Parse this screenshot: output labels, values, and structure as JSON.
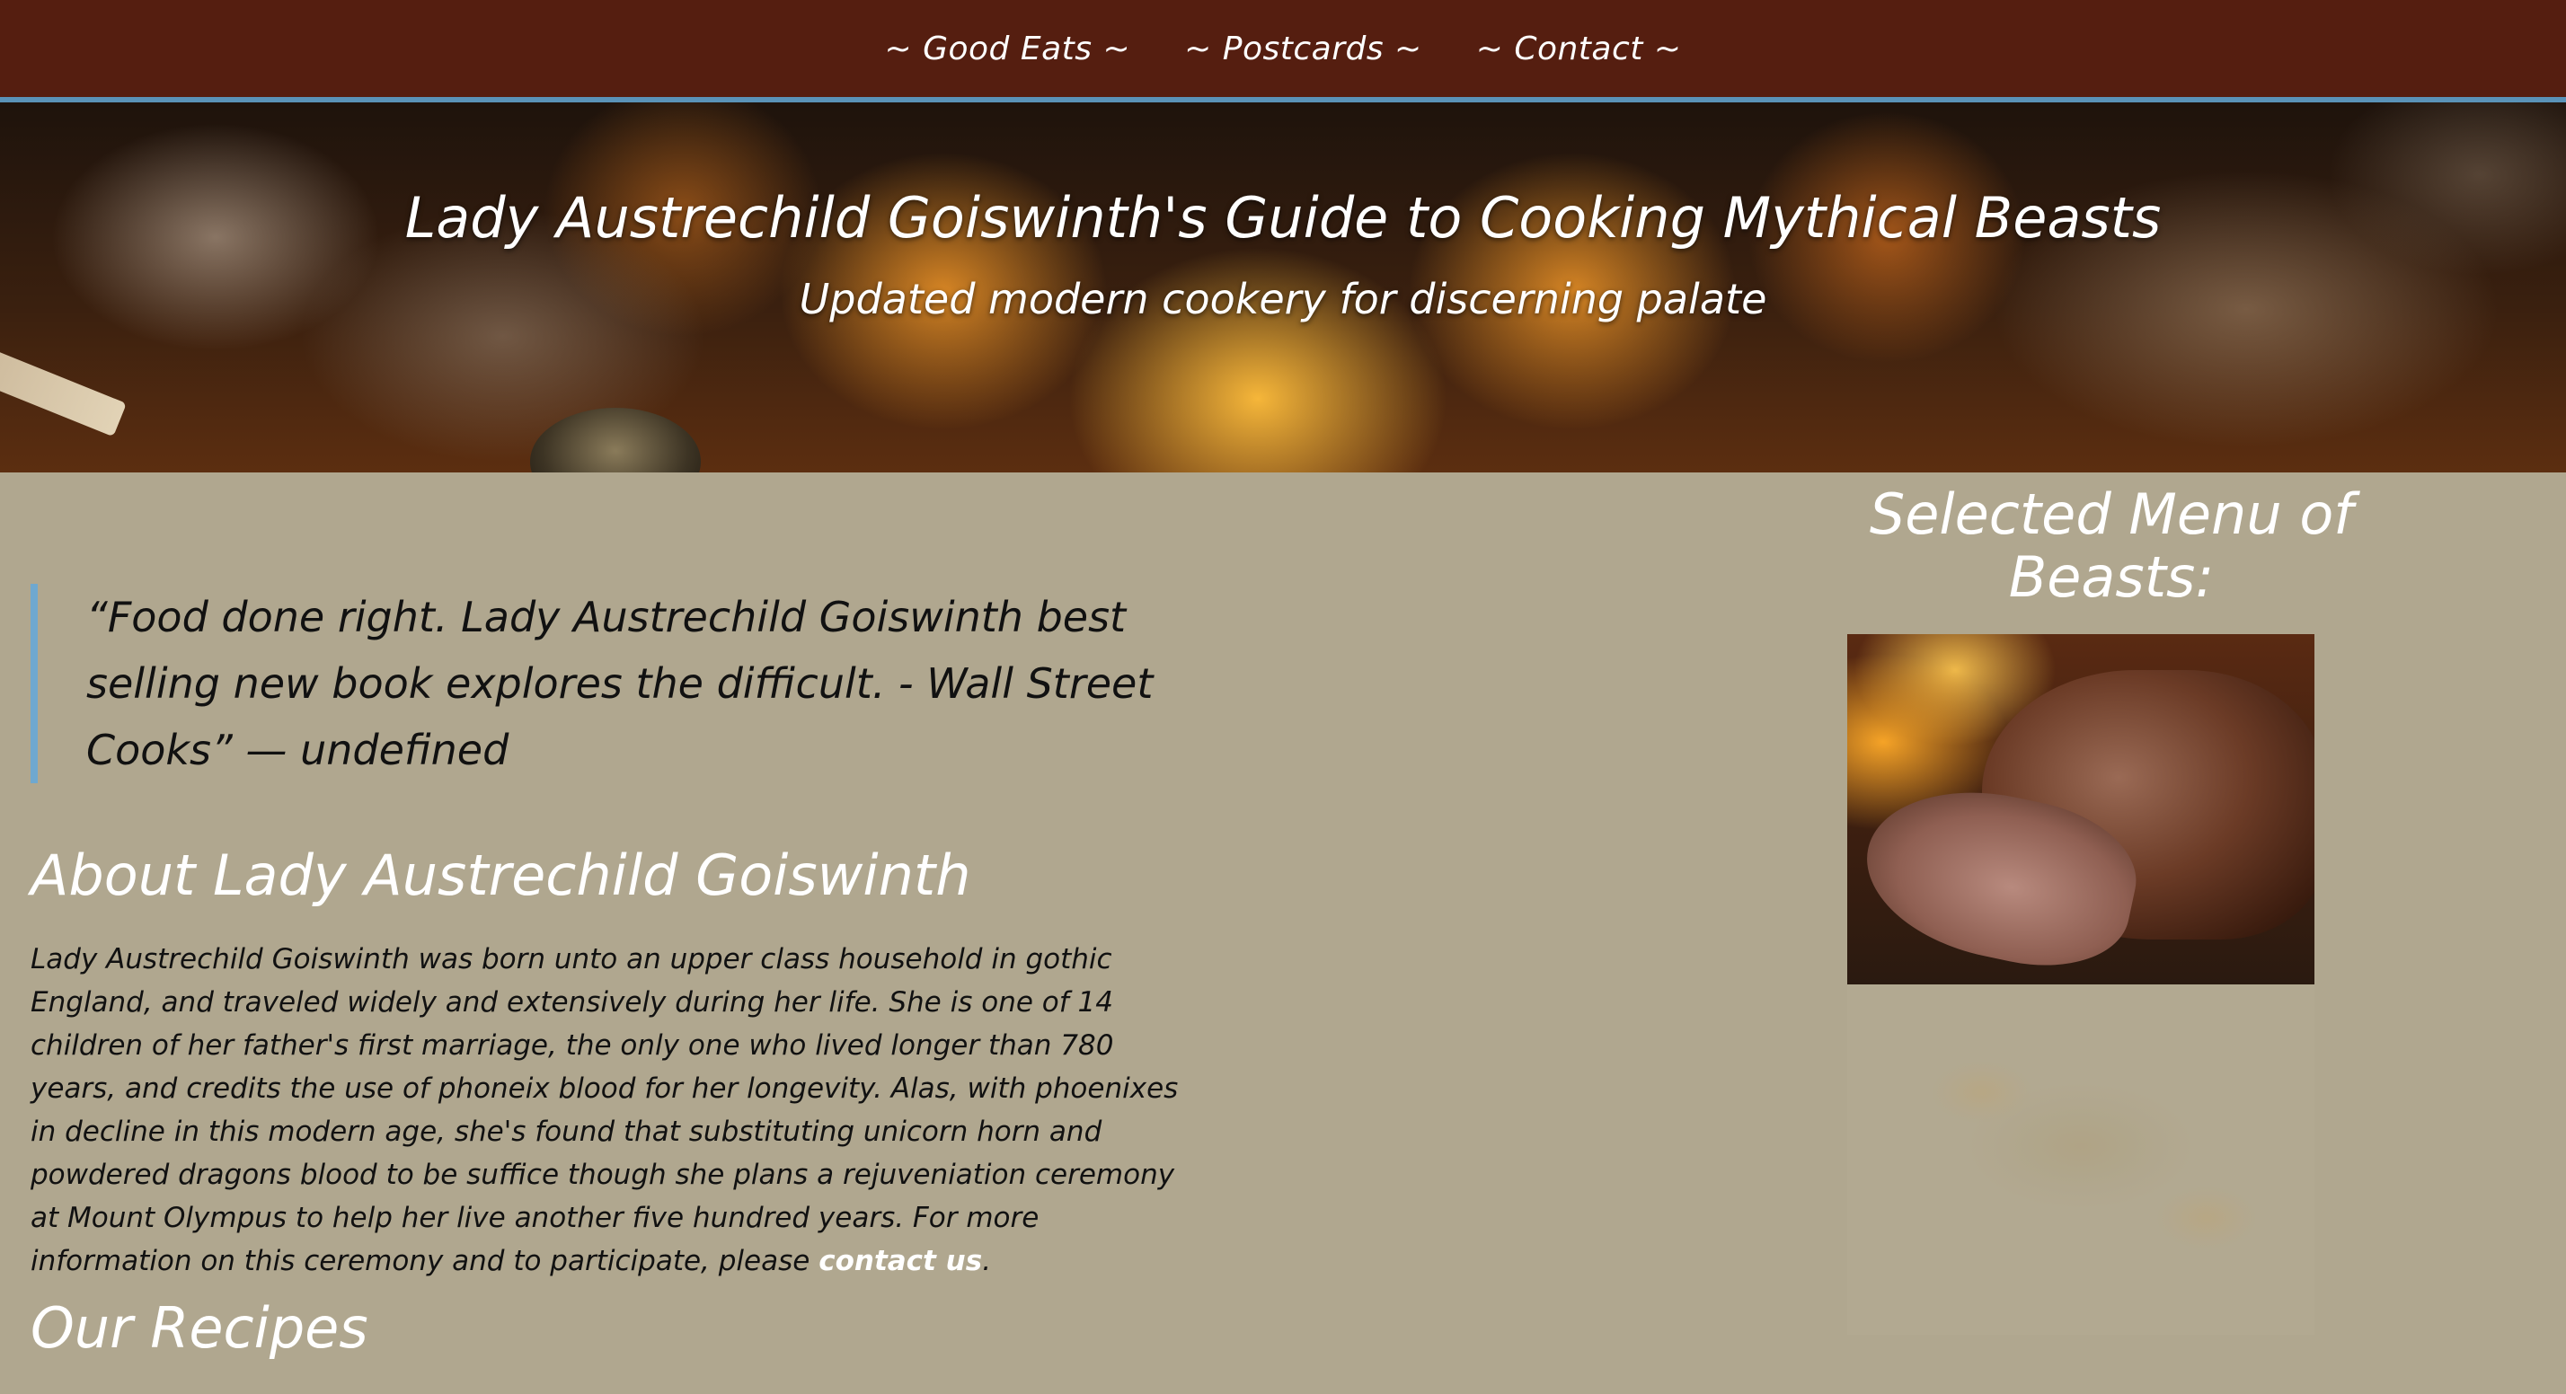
{
  "nav": {
    "items": [
      {
        "label": "~ Good Eats ~"
      },
      {
        "label": "~ Postcards ~"
      },
      {
        "label": "~ Contact ~"
      }
    ]
  },
  "hero": {
    "title": "Lady Austrechild Goiswinth's Guide to Cooking Mythical Beasts",
    "subtitle": "Updated modern cookery for discerning palate"
  },
  "quote": {
    "text": "“Food done right. Lady Austrechild Goiswinth best selling new book explores the difficult. - Wall Street Cooks” — undefined"
  },
  "about": {
    "heading": "About Lady Austrechild Goiswinth",
    "text": "Lady Austrechild Goiswinth was born unto an upper class household in gothic England, and traveled widely and extensively during her life. She is one of 14 children of her father's first marriage, the only one who lived longer than 780 years, and credits the use of phoneix blood for her longevity. Alas, with phoenixes in decline in this modern age, she's found that substituting unicorn horn and powdered dragons blood to be suffice though she plans a rejuveniation ceremony at Mount Olympus to help her live another five hundred years. For more information on this ceremony and to participate, please",
    "link_label": "contact us",
    "end_punct": "."
  },
  "recipes": {
    "heading": "Our Recipes"
  },
  "sidebar": {
    "heading": "Selected Menu of Beasts:"
  },
  "colors": {
    "nav_bg": "#551e10",
    "nav_border": "#5a93b8",
    "page_bg": "#b0a78f",
    "quote_border": "#6fa8cf"
  }
}
